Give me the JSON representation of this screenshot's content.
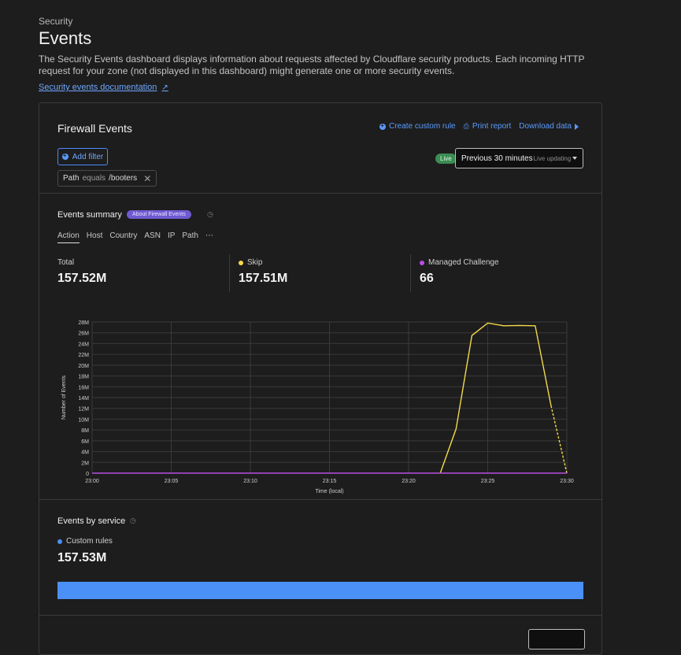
{
  "breadcrumb": "Security",
  "page_title": "Events",
  "description": "The Security Events dashboard displays information about requests affected by Cloudflare security products. Each incoming HTTP request for your zone (not displayed in this dashboard) might generate one or more security events.",
  "doc_link": "Security events documentation",
  "card": {
    "title": "Firewall Events",
    "create_rule": "Create custom rule",
    "print_report": "Print report",
    "download": "Download data",
    "add_filter": "Add filter",
    "filter": {
      "field": "Path",
      "operator": "equals",
      "value": "/booters"
    },
    "live_badge": "Live",
    "time_range": "Previous 30 minutes",
    "time_sub": "Live updating"
  },
  "summary": {
    "title": "Events summary",
    "about": "About Firewall Events",
    "tabs": [
      "Action",
      "Host",
      "Country",
      "ASN",
      "IP",
      "Path",
      "⋯"
    ],
    "stats": [
      {
        "label": "Total",
        "value": "157.52M",
        "color": ""
      },
      {
        "label": "Skip",
        "value": "157.51M",
        "color": "#f5d94a"
      },
      {
        "label": "Managed Challenge",
        "value": "66",
        "color": "#b84fe0"
      }
    ]
  },
  "chart_data": {
    "type": "line",
    "xlabel": "Time (local)",
    "ylabel": "Number of Events",
    "x_ticks": [
      "23:00",
      "23:05",
      "23:10",
      "23:15",
      "23:20",
      "23:25",
      "23:30"
    ],
    "y_ticks": [
      "0",
      "2M",
      "4M",
      "6M",
      "8M",
      "10M",
      "12M",
      "14M",
      "16M",
      "18M",
      "20M",
      "22M",
      "24M",
      "26M",
      "28M"
    ],
    "xlim": [
      0,
      30
    ],
    "ylim": [
      0,
      28000000
    ],
    "grid": true,
    "series": [
      {
        "name": "Skip",
        "color": "#f5d94a",
        "points": [
          [
            22,
            0
          ],
          [
            23,
            8200000
          ],
          [
            24,
            25500000
          ],
          [
            25,
            27800000
          ],
          [
            26,
            27300000
          ],
          [
            27,
            27350000
          ],
          [
            28,
            27300000
          ],
          [
            29,
            12500000
          ]
        ],
        "dashed_points": [
          [
            29,
            12500000
          ],
          [
            30,
            0
          ]
        ]
      },
      {
        "name": "Managed Challenge",
        "color": "#b84fe0",
        "points": [
          [
            0,
            0
          ],
          [
            30,
            0
          ]
        ]
      }
    ]
  },
  "services": {
    "title": "Events by service",
    "legend": "Custom rules",
    "legend_color": "#4a90f7",
    "value": "157.53M"
  }
}
